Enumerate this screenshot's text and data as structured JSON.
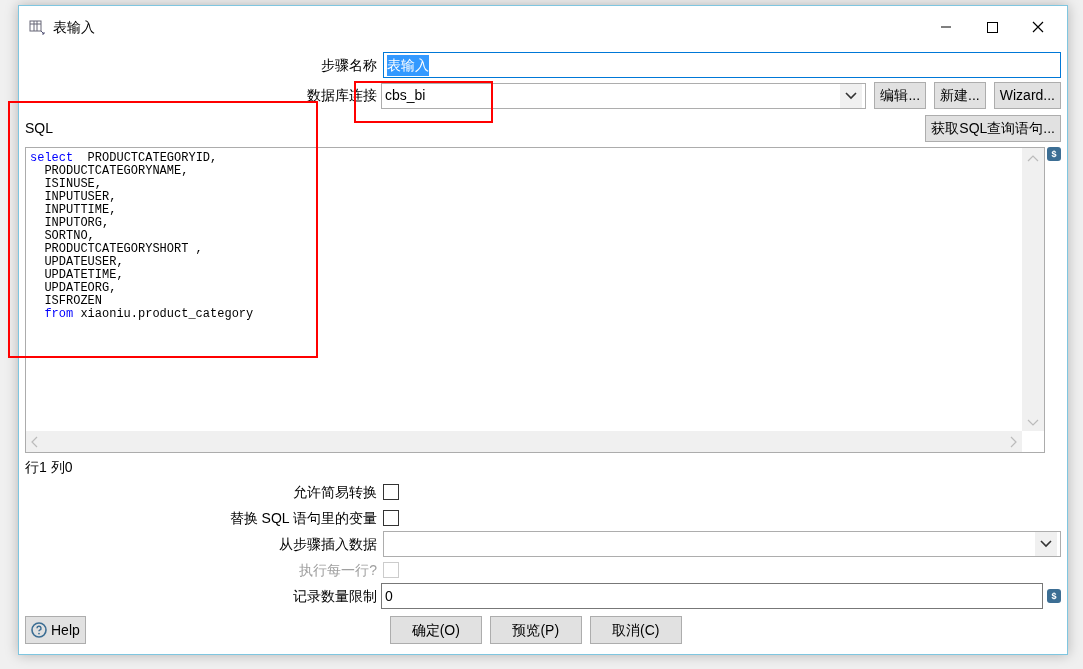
{
  "window": {
    "title": "表输入"
  },
  "step_name": {
    "label": "步骤名称",
    "value": "表输入",
    "selected": true
  },
  "connection": {
    "label": "数据库连接",
    "value": "cbs_bi",
    "buttons": [
      "编辑...",
      "新建...",
      "Wizard..."
    ]
  },
  "sql": {
    "label": "SQL",
    "get_button": "获取SQL查询语句...",
    "variable_marker": "$",
    "lines": [
      {
        "indented": false,
        "tokens": [
          {
            "kind": "keyword",
            "text": "select"
          },
          {
            "kind": "plain",
            "text": "  PRODUCTCATEGORYID,"
          }
        ]
      },
      {
        "indented": true,
        "tokens": [
          {
            "kind": "plain",
            "text": "PRODUCTCATEGORYNAME,"
          }
        ]
      },
      {
        "indented": true,
        "tokens": [
          {
            "kind": "plain",
            "text": "ISINUSE,"
          }
        ]
      },
      {
        "indented": true,
        "tokens": [
          {
            "kind": "plain",
            "text": "INPUTUSER,"
          }
        ]
      },
      {
        "indented": true,
        "tokens": [
          {
            "kind": "plain",
            "text": "INPUTTIME,"
          }
        ]
      },
      {
        "indented": true,
        "tokens": [
          {
            "kind": "plain",
            "text": "INPUTORG,"
          }
        ]
      },
      {
        "indented": true,
        "tokens": [
          {
            "kind": "plain",
            "text": "SORTNO,"
          }
        ]
      },
      {
        "indented": true,
        "tokens": [
          {
            "kind": "plain",
            "text": "PRODUCTCATEGORYSHORT ,"
          }
        ]
      },
      {
        "indented": true,
        "tokens": [
          {
            "kind": "plain",
            "text": "UPDATEUSER,"
          }
        ]
      },
      {
        "indented": true,
        "tokens": [
          {
            "kind": "plain",
            "text": "UPDATETIME,"
          }
        ]
      },
      {
        "indented": true,
        "tokens": [
          {
            "kind": "plain",
            "text": "UPDATEORG,"
          }
        ]
      },
      {
        "indented": true,
        "tokens": [
          {
            "kind": "plain",
            "text": "ISFROZEN"
          }
        ]
      },
      {
        "indented": true,
        "tokens": [
          {
            "kind": "keyword",
            "text": "from"
          },
          {
            "kind": "plain",
            "text": " xiaoniu.product_category"
          }
        ]
      }
    ],
    "position": "行1 列0"
  },
  "options": [
    {
      "kind": "checkbox",
      "label": "允许简易转换",
      "checked": false,
      "disabled": false
    },
    {
      "kind": "checkbox",
      "label": "替换 SQL 语句里的变量",
      "checked": false,
      "disabled": false
    },
    {
      "kind": "combo",
      "label": "从步骤插入数据"
    },
    {
      "kind": "checkbox",
      "label": "执行每一行?",
      "checked": false,
      "disabled": true
    },
    {
      "kind": "text",
      "label": "记录数量限制",
      "value": "0",
      "variable_marker": "$"
    }
  ],
  "help_button": "Help",
  "buttons": [
    "确定(O)",
    "预览(P)",
    "取消(C)"
  ],
  "annotations": [
    {
      "color": "#ff0000"
    },
    {
      "color": "#ff0000"
    }
  ]
}
